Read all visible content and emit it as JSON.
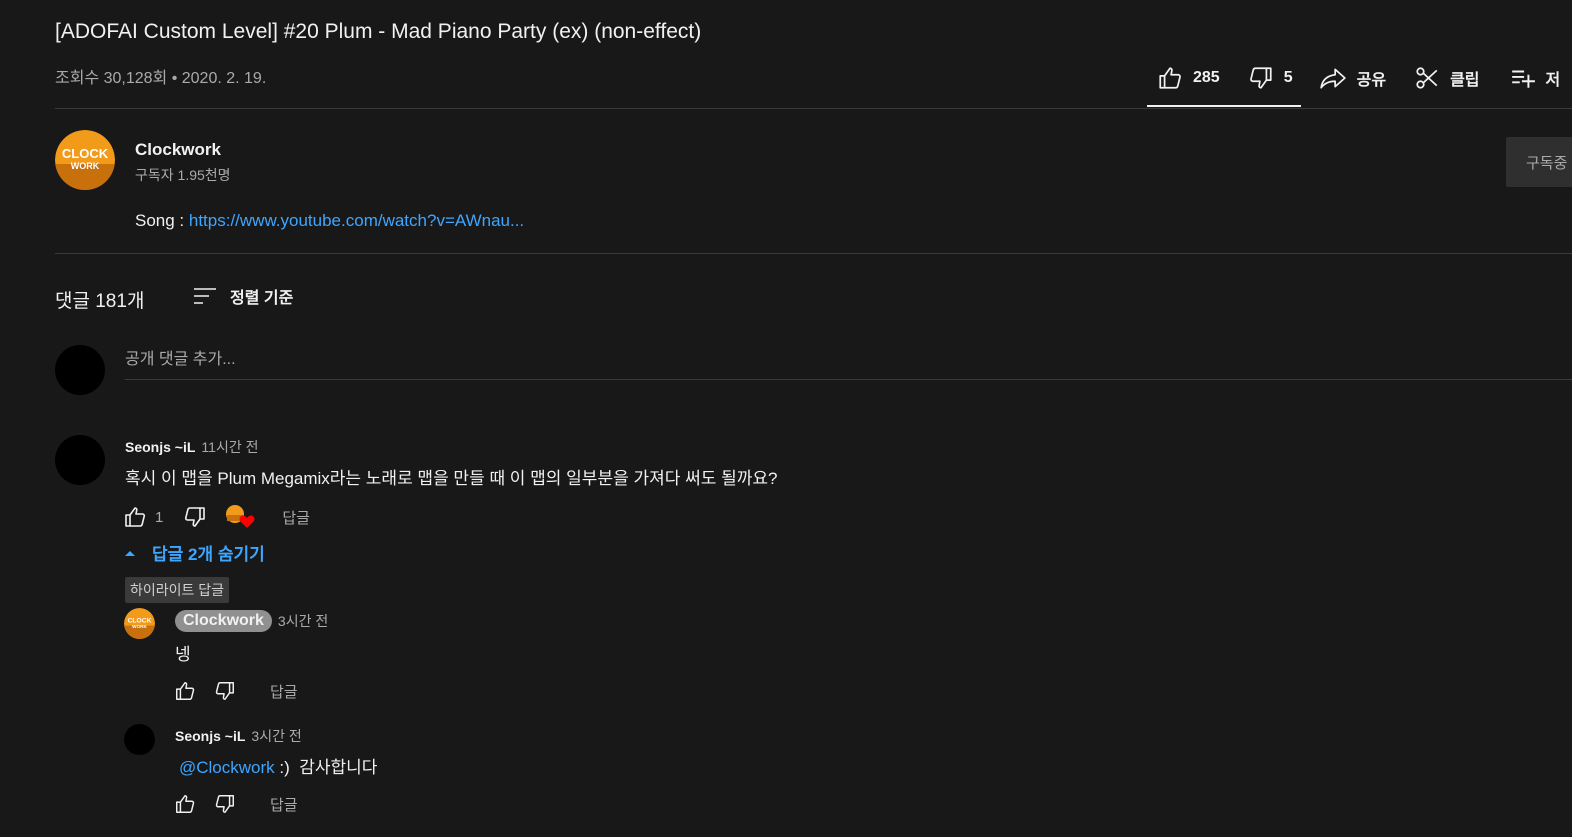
{
  "video": {
    "title": "[ADOFAI Custom Level] #20 Plum - Mad Piano Party (ex) (non-effect)",
    "meta": "조회수 30,128회 • 2020. 2. 19."
  },
  "actions": {
    "like_count": "285",
    "dislike_count": "5",
    "share_label": "공유",
    "clip_label": "클립",
    "save_label": "저"
  },
  "channel": {
    "name": "Clockwork",
    "subscribers": "구독자 1.95천명",
    "subscribe_label": "구독중",
    "logo_text_1": "CLOCK",
    "logo_text_2": "WORK"
  },
  "description": {
    "prefix": "Song : ",
    "link": "https://www.youtube.com/watch?v=AWnau..."
  },
  "comments_header": {
    "count": "댓글 181개",
    "sort_label": "정렬 기준",
    "add_placeholder": "공개 댓글 추가..."
  },
  "comment": {
    "author": "Seonjs ~iL",
    "time": "11시간 전",
    "text": "혹시 이 맵을 Plum Megamix라는 노래로 맵을 만들 때 이 맵의 일부분을 가져다 써도 될까요?",
    "like_count": "1",
    "reply_label": "답글",
    "hide_replies_label": "답글 2개 숨기기"
  },
  "replies": [
    {
      "badge": "하이라이트 답글",
      "author": "Clockwork",
      "time": "3시간 전",
      "text": "넹",
      "reply_label": "답글"
    },
    {
      "author": "Seonjs ~iL",
      "time": "3시간 전",
      "mention": "@Clockwork",
      "text": " :)  감사합니다",
      "reply_label": "답글"
    }
  ],
  "colors": {
    "background": "#181818",
    "link": "#3ea6ff",
    "logo_orange": "#f29a1a",
    "heart": "#ff0000"
  }
}
